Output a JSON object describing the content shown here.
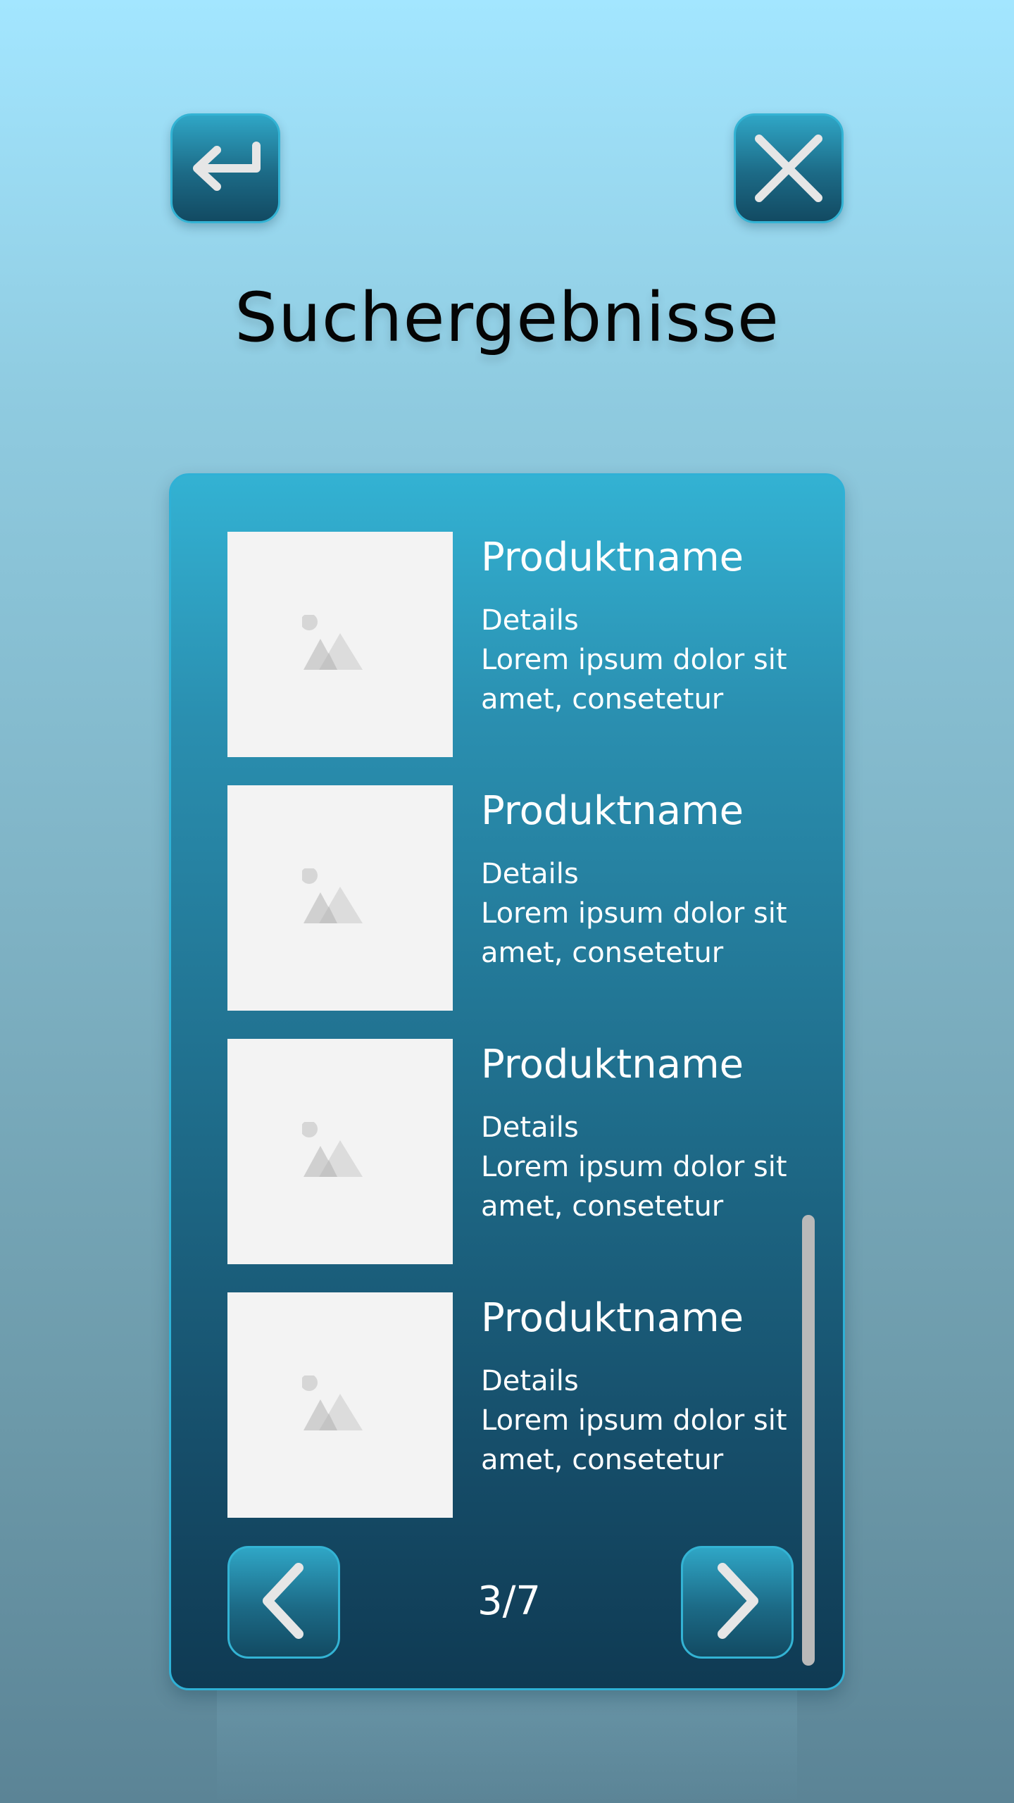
{
  "header": {
    "title": "Suchergebnisse",
    "back_icon": "return-arrow-icon",
    "close_icon": "close-icon"
  },
  "results": [
    {
      "name": "Produktname",
      "details": "Details",
      "description": "Lorem ipsum dolor sit amet, consetetur",
      "image_icon": "image-placeholder-icon"
    },
    {
      "name": "Produktname",
      "details": "Details",
      "description": "Lorem ipsum dolor sit amet, consetetur",
      "image_icon": "image-placeholder-icon"
    },
    {
      "name": "Produktname",
      "details": "Details",
      "description": "Lorem ipsum dolor sit amet, consetetur",
      "image_icon": "image-placeholder-icon"
    },
    {
      "name": "Produktname",
      "details": "Details",
      "description": "Lorem ipsum dolor sit amet, consetetur",
      "image_icon": "image-placeholder-icon"
    }
  ],
  "pagination": {
    "label": "3/7",
    "prev_icon": "chevron-left-icon",
    "next_icon": "chevron-right-icon"
  },
  "colors": {
    "accent": "#33b3d4",
    "panel_top": "#33b2d3",
    "panel_bottom": "#0f3a53",
    "icon_glyph": "#e6e6e6"
  }
}
